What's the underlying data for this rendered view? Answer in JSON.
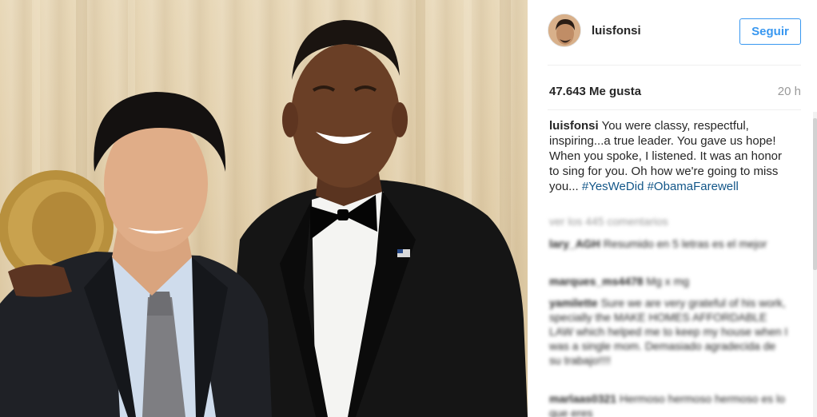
{
  "post": {
    "username": "luisfonsi",
    "follow_label": "Seguir",
    "likes": "47.643 Me gusta",
    "time_ago": "20 h",
    "caption_user": "luisfonsi",
    "caption_text": "You were classy, respectful, inspiring...a true leader. You gave us hope! When you spoke, I listened. It was an honor to sing for you. Oh how we're going to miss you...",
    "hashtag_1": "#YesWeDid",
    "hashtag_2": "#ObamaFarewell"
  },
  "comments": {
    "view_more": "ver los 445 comentarios",
    "items": [
      {
        "user": "lary_AGH",
        "text": "Resumido en 5 letras es el mejor"
      },
      {
        "user": "marques_ms4478",
        "text": "Mg x mg"
      },
      {
        "user": "yamilette",
        "text": "Sure we are very grateful of his work, specially the MAKE HOMES AFFORDABLE LAW which helped me to keep my house when I was a single mom. Demasiado agradecida de su trabajo!!!!"
      },
      {
        "user": "marlaas0321",
        "text": "Hermoso hermoso hermoso es lo que eres"
      }
    ]
  },
  "colors": {
    "link": "#125688",
    "follow": "#3897f0",
    "muted": "#999999"
  }
}
